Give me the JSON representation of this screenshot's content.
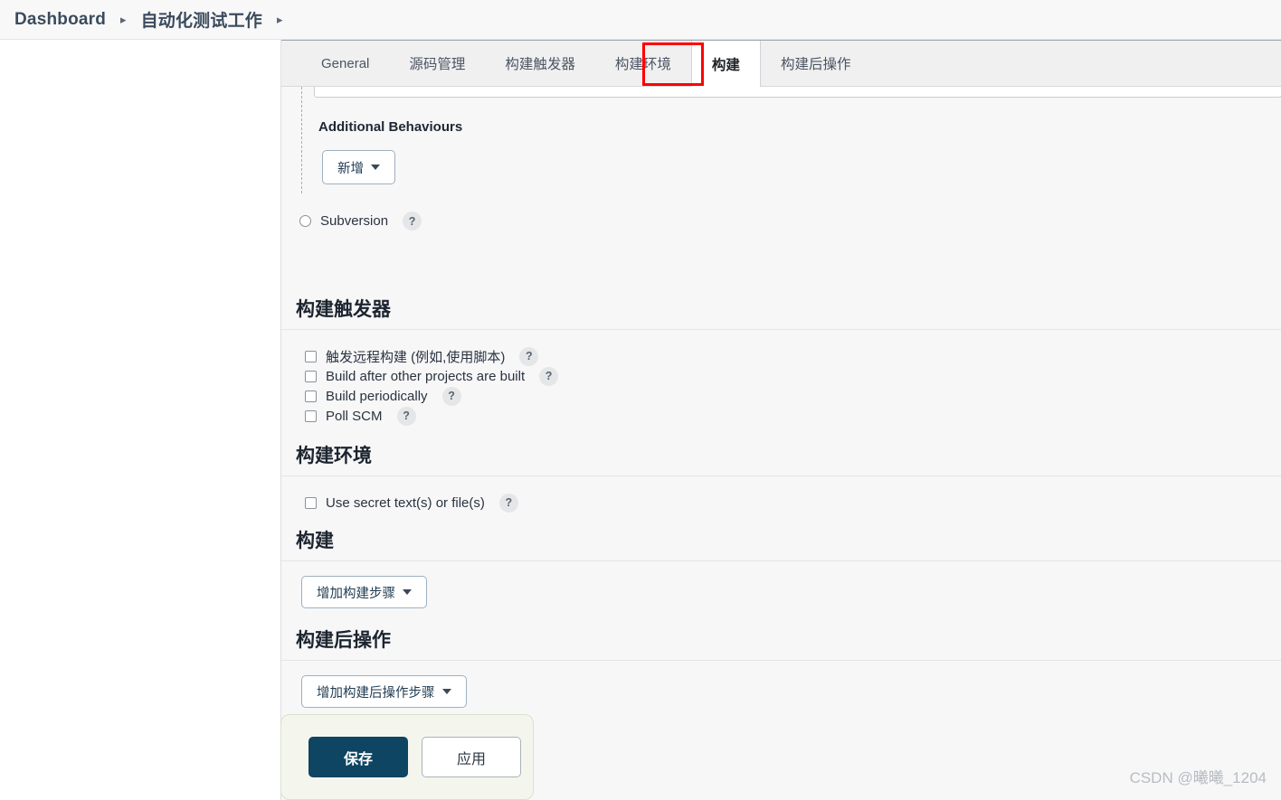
{
  "breadcrumb": {
    "items": [
      {
        "label": "Dashboard"
      },
      {
        "label": "自动化测试工作"
      }
    ],
    "separator": "▸"
  },
  "tabs": [
    {
      "label": "General",
      "active": false
    },
    {
      "label": "源码管理",
      "active": false
    },
    {
      "label": "构建触发器",
      "active": false
    },
    {
      "label": "构建环境",
      "active": false
    },
    {
      "label": "构建",
      "active": true,
      "highlighted": true
    },
    {
      "label": "构建后操作",
      "active": false
    }
  ],
  "scm_section": {
    "additional_behaviours_title": "Additional Behaviours",
    "add_button_label": "新增",
    "subversion_label": "Subversion",
    "help_badge": "?"
  },
  "build_triggers": {
    "title": "构建触发器",
    "options": [
      {
        "label": "触发远程构建 (例如,使用脚本)",
        "checked": false,
        "help": "?"
      },
      {
        "label": "Build after other projects are built",
        "checked": false,
        "help": "?"
      },
      {
        "label": "Build periodically",
        "checked": false,
        "help": "?"
      },
      {
        "label": "Poll SCM",
        "checked": false,
        "help": "?"
      }
    ]
  },
  "build_environment": {
    "title": "构建环境",
    "options": [
      {
        "label": "Use secret text(s) or file(s)",
        "checked": false,
        "help": "?"
      }
    ]
  },
  "build": {
    "title": "构建",
    "add_step_label": "增加构建步骤"
  },
  "post_build": {
    "title": "构建后操作",
    "add_step_label": "增加构建后操作步骤"
  },
  "footer": {
    "save_label": "保存",
    "apply_label": "应用"
  },
  "watermark": "CSDN @曦曦_1204",
  "colors": {
    "save_button": "#0d4562",
    "highlight_box": "#ff0000",
    "panel_background": "#f7f7f8",
    "tabbar_background": "#f0f0f0",
    "footer_background": "#f4f6ee"
  }
}
